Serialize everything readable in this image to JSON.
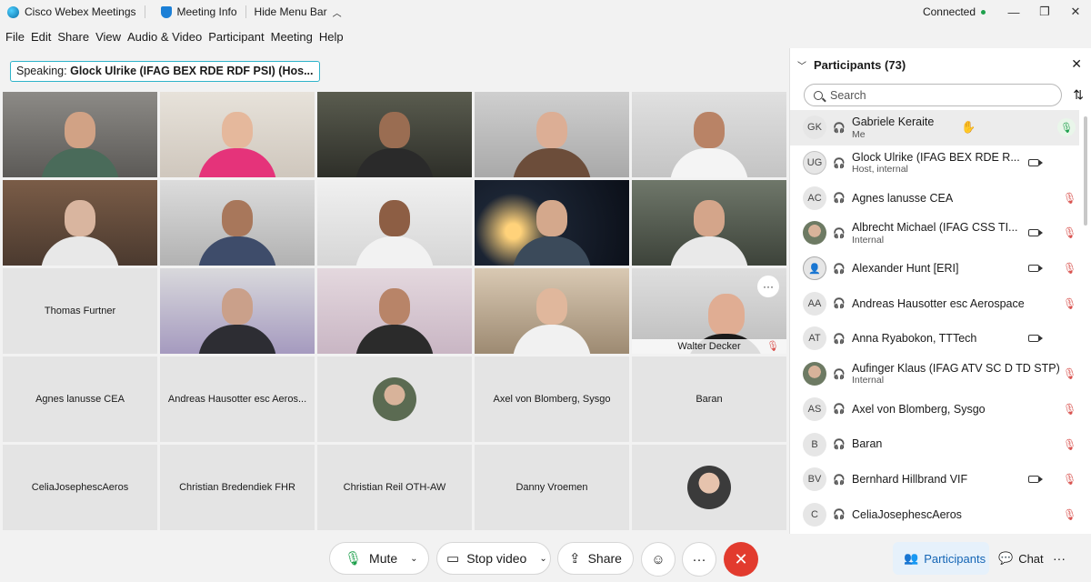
{
  "titlebar": {
    "app_name": "Cisco Webex Meetings",
    "meeting_info": "Meeting Info",
    "hide_menu": "Hide Menu Bar",
    "status": "Connected"
  },
  "menu": [
    "File",
    "Edit",
    "Share",
    "View",
    "Audio & Video",
    "Participant",
    "Meeting",
    "Help"
  ],
  "speaking": {
    "prefix": "Speaking:",
    "name": "Glock Ulrike (IFAG BEX RDE RDF PSI) (Hos..."
  },
  "tiles": {
    "thomas": "Thomas Furtner",
    "walter": "Walter Decker",
    "agnes": "Agnes lanusse CEA",
    "andreas": "Andreas Hausotter esc Aeros...",
    "axel": "Axel von Blomberg, Sysgo",
    "baran": "Baran",
    "celia": "CeliaJosephescAeros",
    "christian_b": "Christian Bredendiek FHR",
    "christian_r": "Christian Reil OTH-AW",
    "danny": "Danny Vroemen"
  },
  "panel": {
    "title": "Participants (73)",
    "search_placeholder": "Search",
    "participants": [
      {
        "initials": "GK",
        "name": "Gabriele Keraite",
        "sub": "Me"
      },
      {
        "initials": "UG",
        "name": "Glock Ulrike (IFAG BEX RDE R...",
        "sub": "Host, internal"
      },
      {
        "initials": "AC",
        "name": "Agnes lanusse CEA",
        "sub": ""
      },
      {
        "initials": "",
        "name": "Albrecht Michael (IFAG CSS TI...",
        "sub": "Internal"
      },
      {
        "initials": "",
        "name": "Alexander Hunt [ERI]",
        "sub": ""
      },
      {
        "initials": "AA",
        "name": "Andreas Hausotter esc Aerospace",
        "sub": ""
      },
      {
        "initials": "AT",
        "name": "Anna Ryabokon, TTTech",
        "sub": ""
      },
      {
        "initials": "",
        "name": "Aufinger Klaus (IFAG ATV SC D TD STP)",
        "sub": "Internal"
      },
      {
        "initials": "AS",
        "name": "Axel von Blomberg, Sysgo",
        "sub": ""
      },
      {
        "initials": "B",
        "name": "Baran",
        "sub": ""
      },
      {
        "initials": "BV",
        "name": "Bernhard Hillbrand VIF",
        "sub": ""
      },
      {
        "initials": "C",
        "name": "CeliaJosephescAeros",
        "sub": ""
      }
    ]
  },
  "controls": {
    "mute": "Mute",
    "stop_video": "Stop video",
    "share": "Share",
    "participants": "Participants",
    "chat": "Chat"
  },
  "colors": {
    "accent": "#2eb3c9",
    "end_call": "#e23b2e",
    "mute_red": "#d9534f",
    "active_blue": "#1465b5"
  }
}
